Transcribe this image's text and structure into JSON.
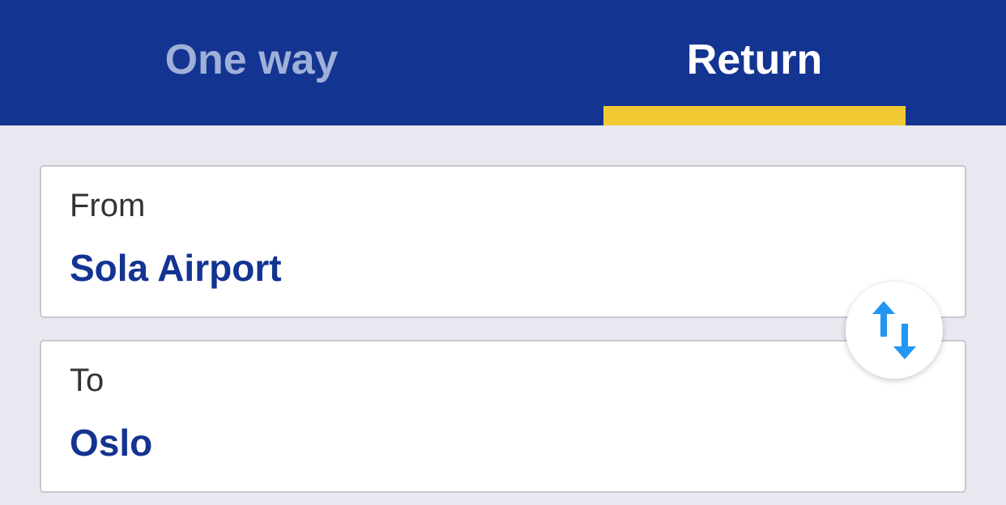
{
  "tabs": {
    "one_way": "One way",
    "return": "Return",
    "active": "return"
  },
  "from": {
    "label": "From",
    "value": "Sola Airport"
  },
  "to": {
    "label": "To",
    "value": "Oslo"
  },
  "colors": {
    "brand_blue": "#143492",
    "accent_yellow": "#f1c932",
    "inactive_tab": "#9fb0d9",
    "swap_icon": "#2196f3",
    "background": "#e8e9f0"
  },
  "icons": {
    "swap": "swap-vertical-arrows-icon"
  }
}
